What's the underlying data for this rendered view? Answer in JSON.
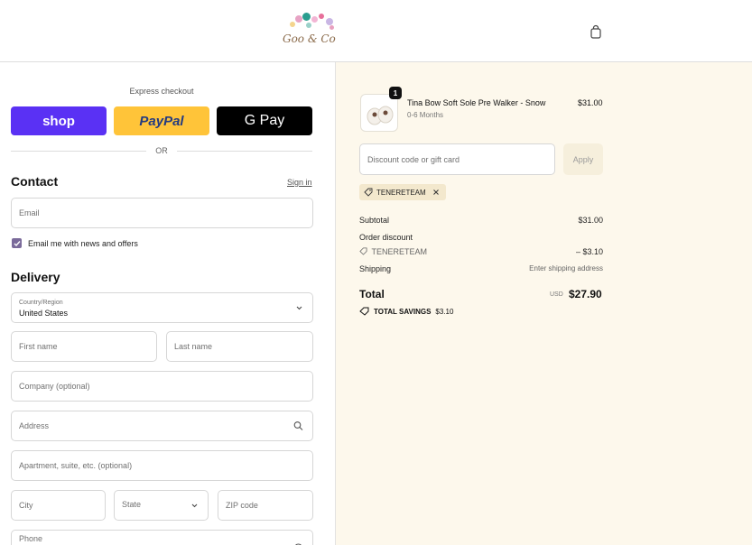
{
  "brand": {
    "logo_text": "Goo & Co"
  },
  "express": {
    "label": "Express checkout",
    "shop_label": "shop",
    "paypal_label": "PayPal",
    "gpay_label": "G Pay",
    "or_label": "OR"
  },
  "contact": {
    "title": "Contact",
    "signin_label": "Sign in",
    "email_placeholder": "Email",
    "newsletter_label": "Email me with news and offers",
    "newsletter_checked": true
  },
  "delivery": {
    "title": "Delivery",
    "country_label": "Country/Region",
    "country_value": "United States",
    "first_name_placeholder": "First name",
    "last_name_placeholder": "Last name",
    "company_placeholder": "Company (optional)",
    "address_placeholder": "Address",
    "apartment_placeholder": "Apartment, suite, etc. (optional)",
    "city_placeholder": "City",
    "state_placeholder": "State",
    "zip_placeholder": "ZIP code",
    "phone_placeholder": "Phone"
  },
  "order": {
    "item": {
      "name": "Tina Bow Soft Sole Pre Walker - Snow",
      "variant": "0-6 Months",
      "price": "$31.00",
      "quantity": "1"
    },
    "discount_placeholder": "Discount code or gift card",
    "apply_label": "Apply",
    "applied_code": "TENERETEAM",
    "subtotal_label": "Subtotal",
    "subtotal_value": "$31.00",
    "order_discount_label": "Order discount",
    "discount_code": "TENERETEAM",
    "discount_value": "– $3.10",
    "shipping_label": "Shipping",
    "shipping_value": "Enter shipping address",
    "total_label": "Total",
    "total_currency": "USD",
    "total_value": "$27.90",
    "savings_label": "TOTAL SAVINGS",
    "savings_value": "$3.10"
  },
  "colors": {
    "shop_purple": "#5a31f4",
    "paypal_yellow": "#ffc439",
    "summary_bg": "#fdf8ec",
    "chip_bg": "#f3e8cd"
  }
}
